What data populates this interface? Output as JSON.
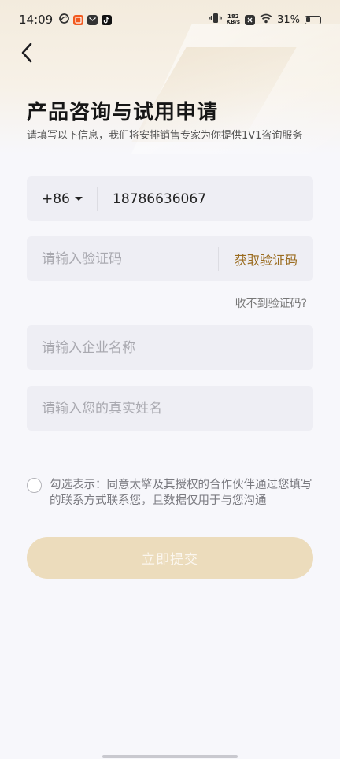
{
  "status_bar": {
    "time": "14:09",
    "net_speed_value": "182",
    "net_speed_unit": "KB/s",
    "battery": "31%",
    "icons": [
      "weibo-icon",
      "taobao-icon",
      "mail-icon",
      "tiktok-icon",
      "vibrate-icon",
      "nfc-icon",
      "wifi-icon",
      "battery-icon"
    ]
  },
  "header": {
    "title": "产品咨询与试用申请",
    "subtitle": "请填写以下信息，我们将安排销售专家为你提供1V1咨询服务"
  },
  "form": {
    "country_code": "+86",
    "phone_value": "18786636067",
    "code_placeholder": "请输入验证码",
    "get_code_label": "获取验证码",
    "no_code_link": "收不到验证码?",
    "company_placeholder": "请输入企业名称",
    "name_placeholder": "请输入您的真实姓名",
    "consent_text": "勾选表示：同意太擎及其授权的合作伙伴通过您填写的联系方式联系您，且数据仅用于与您沟通",
    "submit_label": "立即提交"
  },
  "colors": {
    "accent": "#9a6b1e",
    "submit_bg": "#ecdcbc",
    "field_bg": "#eeeef4",
    "page_bg": "#f7f7fb"
  }
}
